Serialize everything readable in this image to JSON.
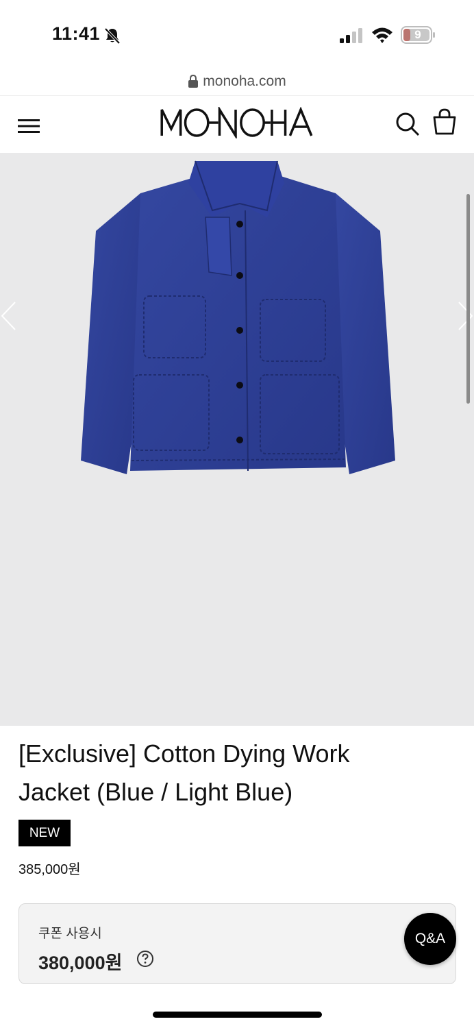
{
  "status_bar": {
    "time": "11:41",
    "battery_level": "9"
  },
  "browser": {
    "url": "monoha.com"
  },
  "header": {
    "logo": "MONOHA"
  },
  "product": {
    "title": "[Exclusive] Cotton Dying Work Jacket (Blue / Light Blue)",
    "badge": "NEW",
    "price": "385,000원",
    "coupon_label": "쿠폰 사용시",
    "coupon_price": "380,000원",
    "image_alt": "blue cotton work jacket"
  },
  "qa_button": {
    "label": "Q&A"
  },
  "icons": {
    "menu": "menu-icon",
    "search": "search-icon",
    "bag": "bag-icon",
    "lock": "lock-icon",
    "help": "help-icon",
    "bell_off": "bell-off-icon"
  },
  "colors": {
    "jacket_blue": "#2e3f94",
    "image_background": "#e9e9ea",
    "badge": "#000000"
  }
}
